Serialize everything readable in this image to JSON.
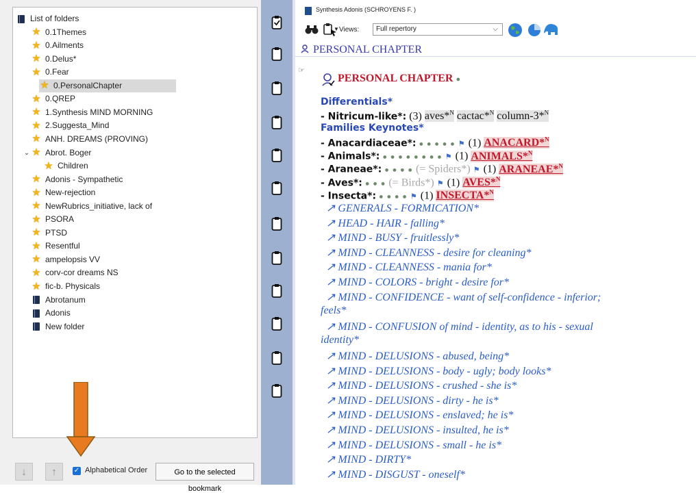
{
  "tree": {
    "items": [
      {
        "label": "List of folders",
        "icon": "book-icon",
        "expander": "⌄",
        "level": 0
      },
      {
        "label": "0.1Themes",
        "icon": "star-icon",
        "level": 1
      },
      {
        "label": "0.Ailments",
        "icon": "star-icon",
        "level": 1
      },
      {
        "label": "0.Delus*",
        "icon": "star-icon",
        "level": 1
      },
      {
        "label": "0.Fear",
        "icon": "star-icon",
        "level": 1
      },
      {
        "label": "0.PersonalChapter",
        "icon": "star-icon",
        "level": 1,
        "selected": true
      },
      {
        "label": "0.QREP",
        "icon": "star-icon",
        "level": 1
      },
      {
        "label": "1.Synthesis MIND MORNING",
        "icon": "star-icon",
        "level": 1
      },
      {
        "label": "2.Suggesta_Mind",
        "icon": "star-icon",
        "level": 1
      },
      {
        "label": "ANH. DREAMS (PROVING)",
        "icon": "star-icon",
        "level": 1
      },
      {
        "label": "Abrot. Boger",
        "icon": "star-icon",
        "expander": "⌄",
        "level": 1
      },
      {
        "label": "Children",
        "icon": "star-icon",
        "level": 2
      },
      {
        "label": "Adonis - Sympathetic",
        "icon": "star-icon",
        "level": 1
      },
      {
        "label": "New-rejection",
        "icon": "star-icon",
        "level": 1
      },
      {
        "label": "NewRubrics_initiative, lack of",
        "icon": "star-icon",
        "level": 1
      },
      {
        "label": "PSORA",
        "icon": "star-icon",
        "level": 1
      },
      {
        "label": "PTSD",
        "icon": "star-icon",
        "level": 1
      },
      {
        "label": "Resentful",
        "icon": "star-icon",
        "level": 1
      },
      {
        "label": "ampelopsis VV",
        "icon": "star-icon",
        "level": 1
      },
      {
        "label": "corv-cor dreams NS",
        "icon": "star-icon",
        "level": 1
      },
      {
        "label": "fic-b. Physicals",
        "icon": "star-icon",
        "level": 1
      },
      {
        "label": "Abrotanum",
        "icon": "book-icon",
        "level": 1
      },
      {
        "label": "Adonis",
        "icon": "book-icon",
        "level": 1
      },
      {
        "label": "New folder",
        "icon": "book-icon",
        "level": 1
      }
    ]
  },
  "bottom": {
    "down_icon": "↓",
    "up_icon": "↑",
    "alphabetical_label": "Alphabetical Order",
    "alphabetical_checked": true,
    "goto_label": "Go to the selected bookmark"
  },
  "right": {
    "title": "Synthesis Adonis (SCHROYENS F. )",
    "views_label": "Views:",
    "views_value": "Full repertory",
    "chapter_header": "PERSONAL CHAPTER",
    "chapter_title": "PERSONAL CHAPTER",
    "differentials_label": "Differentials*",
    "nitricum": {
      "name": "- Nitricum-like*:",
      "count": "(3)",
      "r1": "aves*",
      "r2": "cactac*",
      "r3": "column-3*",
      "sup": "N"
    },
    "families_label": "Families Keynotes*",
    "families": [
      {
        "name": "- Anacardiaceae*:",
        "dots": "● ● ● ● ●",
        "extra": "",
        "count": "(1)",
        "remedy": "ANACARD*",
        "sup": "N"
      },
      {
        "name": "- Animals*:",
        "dots": "● ● ● ● ● ● ● ●",
        "extra": "",
        "count": "(1)",
        "remedy": "ANIMALS*",
        "sup": "N"
      },
      {
        "name": "- Araneae*:",
        "dots": "● ● ● ●",
        "extra": "(= Spiders*)",
        "count": "(1)",
        "remedy": "ARANEAE*",
        "sup": "N"
      },
      {
        "name": "- Aves*:",
        "dots": "● ● ●",
        "extra": "(= Birds*)",
        "count": "(1)",
        "remedy": "AVES*",
        "sup": "N"
      },
      {
        "name": "- Insecta*:",
        "dots": "● ● ● ●",
        "extra": "",
        "count": "(1)",
        "remedy": "INSECTA*",
        "sup": "N"
      }
    ],
    "links": [
      "↗ GENERALS - FORMICATION*",
      "↗ HEAD - HAIR - falling*",
      "↗ MIND - BUSY - fruitlessly*",
      "↗ MIND - CLEANNESS - desire for cleaning*",
      "↗ MIND - CLEANNESS - mania for*",
      "↗ MIND - COLORS - bright - desire for*",
      "↗ MIND - CONFIDENCE - want of self-confidence - inferior;",
      "feels*",
      "↗ MIND - CONFUSION of mind - identity, as to his - sexual",
      "identity*",
      "↗ MIND - DELUSIONS - abused, being*",
      "↗ MIND - DELUSIONS - body - ugly; body looks*",
      "↗ MIND - DELUSIONS - crushed - she is*",
      "↗ MIND - DELUSIONS - dirty - he is*",
      "↗ MIND - DELUSIONS - enslaved; he is*",
      "↗ MIND - DELUSIONS - insulted, he is*",
      "↗ MIND - DELUSIONS - small - he is*",
      "↗ MIND - DIRTY*",
      "↗ MIND - DISGUST - oneself*"
    ]
  },
  "colors": {
    "accent": "#2848b8",
    "remedy_red": "#c0182a",
    "link_blue": "#2a5cc8",
    "strip": "#9db0d0",
    "annotation_arrow": "#e87a22"
  }
}
